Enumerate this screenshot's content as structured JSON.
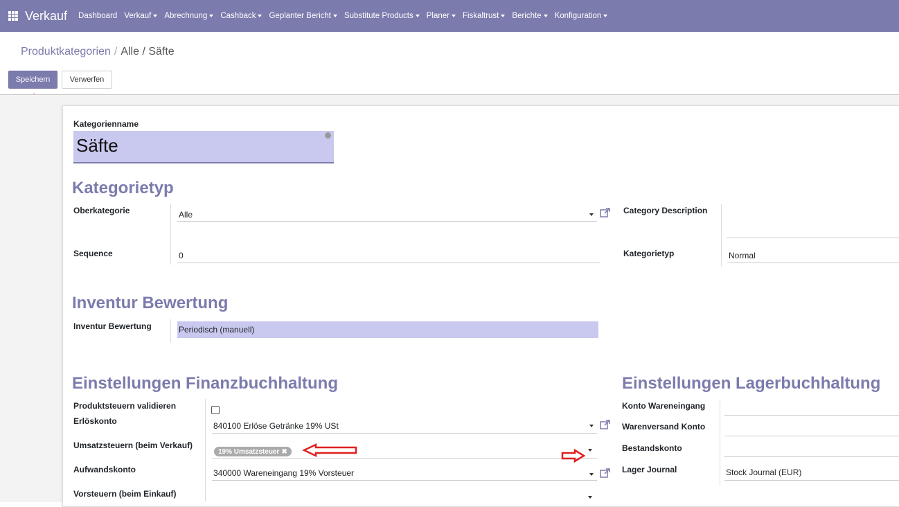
{
  "navbar": {
    "app_title": "Verkauf",
    "menu": [
      {
        "label": "Dashboard",
        "dropdown": false
      },
      {
        "label": "Verkauf",
        "dropdown": true
      },
      {
        "label": "Abrechnung",
        "dropdown": true
      },
      {
        "label": "Cashback",
        "dropdown": true
      },
      {
        "label": "Geplanter Bericht",
        "dropdown": true
      },
      {
        "label": "Substitute Products",
        "dropdown": true
      },
      {
        "label": "Planer",
        "dropdown": true
      },
      {
        "label": "Fiskaltrust",
        "dropdown": true
      },
      {
        "label": "Berichte",
        "dropdown": true
      },
      {
        "label": "Konfiguration",
        "dropdown": true
      }
    ]
  },
  "breadcrumb": {
    "first": "Produktkategorien",
    "separator": "/",
    "rest": "Alle / Säfte"
  },
  "buttons": {
    "save": "Speichern",
    "discard": "Verwerfen"
  },
  "form": {
    "name_label": "Kategorienname",
    "name_value": "Säfte",
    "section_kategorietyp": "Kategorietyp",
    "oberkategorie_label": "Oberkategorie",
    "oberkategorie_value": "Alle",
    "sequence_label": "Sequence",
    "sequence_value": "0",
    "category_description_label": "Category Description",
    "category_description_value": "",
    "kategorietyp_label": "Kategorietyp",
    "kategorietyp_value": "Normal",
    "section_inventur": "Inventur Bewertung",
    "inventur_label": "Inventur Bewertung",
    "inventur_value": "Periodisch (manuell)",
    "section_finanz": "Einstellungen Finanzbuchhaltung",
    "produktsteuern_label": "Produktsteuern validieren",
    "produktsteuern_checked": false,
    "erloeskonto_label": "Erlöskonto",
    "erloeskonto_value": "840100 Erlöse Getränke 19% USt",
    "umsatzsteuern_label": "Umsatzsteuern (beim Verkauf)",
    "umsatzsteuern_tag": "19% Umsatzsteuer",
    "aufwandskonto_label": "Aufwandskonto",
    "aufwandskonto_value": "340000 Wareneingang 19% Vorsteuer",
    "vorsteuern_label": "Vorsteuern (beim Einkauf)",
    "vorsteuern_value": "",
    "section_lager": "Einstellungen Lagerbuchhaltung",
    "konto_wareneingang_label": "Konto Wareneingang",
    "warenversand_label": "Warenversand Konto",
    "bestandskonto_label": "Bestandskonto",
    "lager_journal_label": "Lager Journal",
    "lager_journal_value": "Stock Journal (EUR)"
  },
  "colors": {
    "brand": "#7c7bad",
    "annotation": "#e02020",
    "highlight": "#c9c8ef"
  },
  "icons": {
    "apps": "apps-grid-icon",
    "external": "external-link-icon",
    "globe": "globe-icon",
    "remove_tag": "close-icon"
  }
}
